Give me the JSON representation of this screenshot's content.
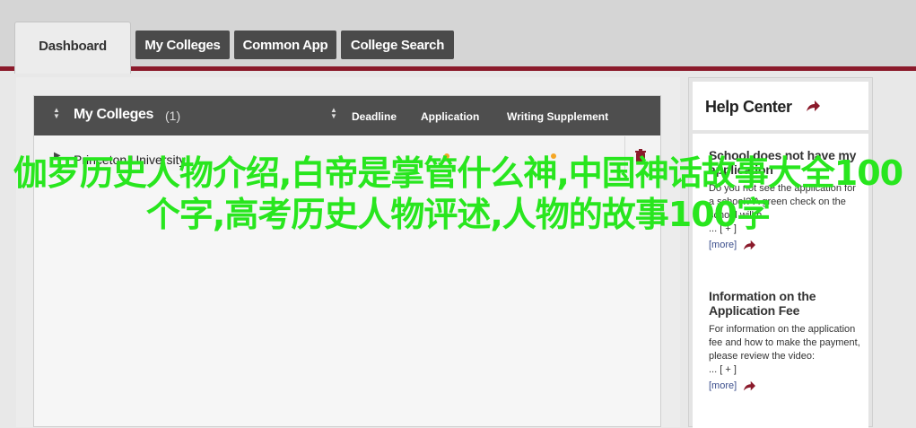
{
  "tabs": [
    {
      "label": "Dashboard",
      "active": true
    },
    {
      "label": "My Colleges"
    },
    {
      "label": "Common App"
    },
    {
      "label": "College Search"
    }
  ],
  "colleges": {
    "title": "My Colleges",
    "count": "(1)",
    "columns": [
      "Deadline",
      "Application",
      "Writing Supplement"
    ],
    "rows": [
      {
        "name": "Princeton University",
        "deadline": "—"
      }
    ]
  },
  "help": {
    "title": "Help Center",
    "articles": [
      {
        "title": "School does not have my application",
        "text": "Do you not see the application for a school? A green check on the school will h",
        "toggle": "... [ + ]",
        "more": "[more]"
      },
      {
        "title": "Information on the Application Fee",
        "text": "For information on the application fee and how to make the payment, please review the video:",
        "toggle": "... [ + ]",
        "more": "[more]"
      }
    ]
  },
  "overlay_text": "伽罗历史人物介绍,白帝是掌管什么神,中国神话故事大全100个字,高考历史人物评述,人物的故事100字",
  "colors": {
    "accent": "#8b1a2b",
    "overlay": "#28e61e",
    "link": "#3b4e8c",
    "status_dot": "#f5a623"
  }
}
